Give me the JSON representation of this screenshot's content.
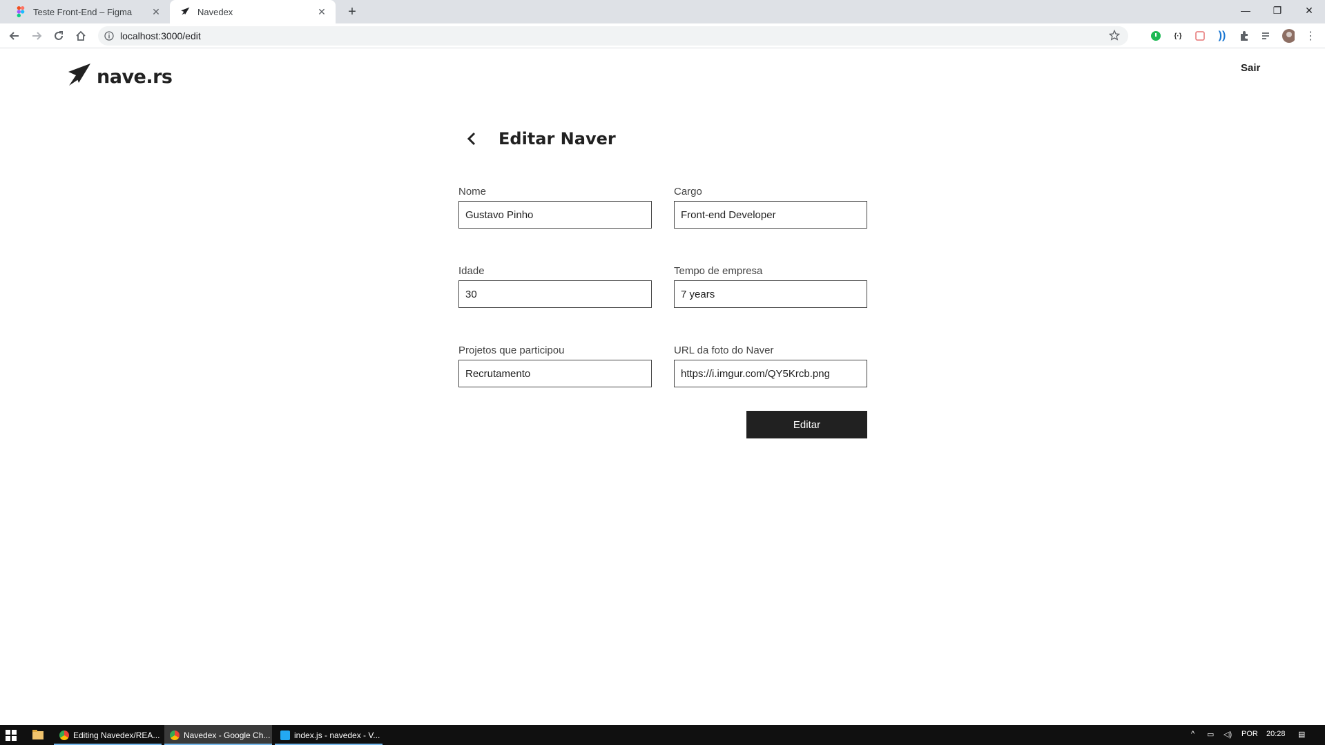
{
  "browser": {
    "tabs": [
      {
        "title": "Teste Front-End – Figma",
        "active": false
      },
      {
        "title": "Navedex",
        "active": true
      }
    ],
    "url": "localhost:3000/edit"
  },
  "app": {
    "brand": "nave.rs",
    "logout_label": "Sair"
  },
  "form": {
    "title": "Editar Naver",
    "fields": {
      "name": {
        "label": "Nome",
        "value": "Gustavo Pinho"
      },
      "job_role": {
        "label": "Cargo",
        "value": "Front-end Developer"
      },
      "age": {
        "label": "Idade",
        "value": "30"
      },
      "admission": {
        "label": "Tempo de empresa",
        "value": "7 years"
      },
      "project": {
        "label": "Projetos que participou",
        "value": "Recrutamento"
      },
      "url": {
        "label": "URL da foto do Naver",
        "value": "https://i.imgur.com/QY5Krcb.png"
      }
    },
    "submit_label": "Editar"
  },
  "taskbar": {
    "items": [
      {
        "label": "Editing Navedex/REA...",
        "active": false
      },
      {
        "label": "Navedex - Google Ch...",
        "active": true
      },
      {
        "label": "index.js - navedex - V...",
        "active": false
      }
    ],
    "language": "POR",
    "time": "20:28"
  },
  "colors": {
    "primary": "#212121",
    "tab_bg": "#dee1e6",
    "taskbar_bg": "#101010"
  }
}
